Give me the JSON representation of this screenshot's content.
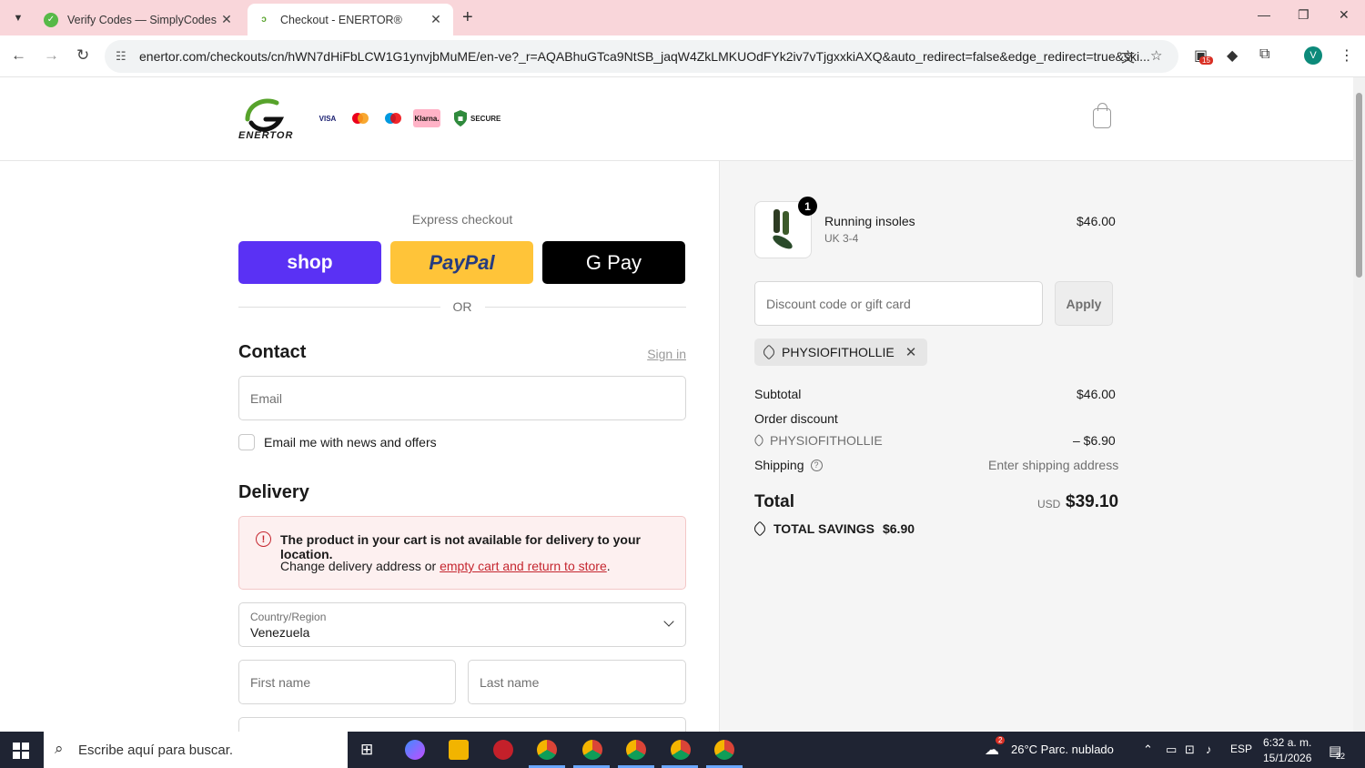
{
  "browser": {
    "tabs": [
      {
        "title": "Verify Codes — SimplyCodes",
        "active": false
      },
      {
        "title": "Checkout - ENERTOR®",
        "active": true
      }
    ],
    "url": "enertor.com/checkouts/cn/hWN7dHiFbLCW1G1ynvjbMuME/en-ve?_r=AQABhuGTca9NtSB_jaqW4ZkLMKUOdFYk2iv7vTjgxxkiAXQ&auto_redirect=false&edge_redirect=true&ski...",
    "extension_badge": "15",
    "profile_initial": "V"
  },
  "header": {
    "brand": "ENERTOR",
    "payment_badges": [
      "VISA",
      "MC",
      "Maestro",
      "Klarna."
    ],
    "secure_label": "SECURE"
  },
  "express": {
    "label": "Express checkout",
    "shop_label": "shop",
    "paypal_label": "PayPal",
    "gpay_label": "G Pay",
    "or_label": "OR"
  },
  "contact": {
    "heading": "Contact",
    "signin": "Sign in",
    "email_placeholder": "Email",
    "newsletter_label": "Email me with news and offers"
  },
  "delivery": {
    "heading": "Delivery",
    "alert_title": "The product in your cart is not available for delivery to your location.",
    "alert_text": "Change delivery address or ",
    "alert_link": "empty cart and return to store",
    "alert_end": ".",
    "country_label": "Country/Region",
    "country_value": "Venezuela",
    "first_name_placeholder": "First name",
    "last_name_placeholder": "Last name"
  },
  "summary": {
    "item_name": "Running insoles",
    "item_variant": "UK 3-4",
    "item_price": "$46.00",
    "item_qty": "1",
    "discount_placeholder": "Discount code or gift card",
    "apply_label": "Apply",
    "applied_code": "PHYSIOFITHOLLIE",
    "subtotal_label": "Subtotal",
    "subtotal_value": "$46.00",
    "order_discount_label": "Order discount",
    "discount_code_line": "PHYSIOFITHOLLIE",
    "discount_value": "– $6.90",
    "shipping_label": "Shipping",
    "shipping_value": "Enter shipping address",
    "total_label": "Total",
    "total_currency": "USD",
    "total_value": "$39.10",
    "savings_label": "TOTAL SAVINGS",
    "savings_value": "$6.90"
  },
  "taskbar": {
    "search_placeholder": "Escribe aquí para buscar.",
    "weather": "26°C  Parc. nublado",
    "language": "ESP",
    "time": "6:32 a. m.",
    "date": "15/1/2026",
    "notifications": "22",
    "weather_badge": "2"
  },
  "colors": {
    "shop_pay": "#5a31f4",
    "paypal": "#ffc439",
    "alert_red": "#c5262f"
  }
}
